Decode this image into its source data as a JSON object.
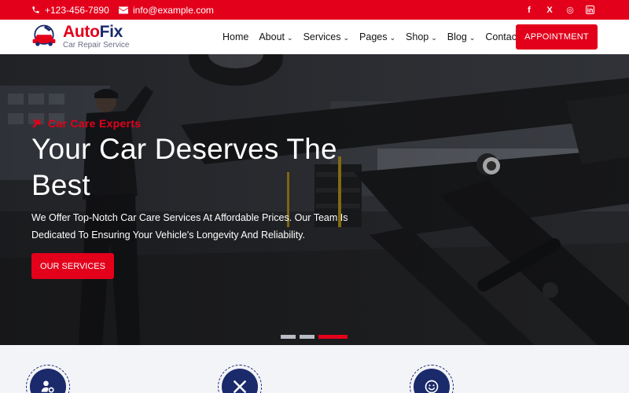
{
  "topbar": {
    "phone": "+123-456-7890",
    "email": "info@example.com",
    "social": [
      {
        "icon": "facebook-icon",
        "glyph": "f"
      },
      {
        "icon": "x-twitter-icon",
        "glyph": "X"
      },
      {
        "icon": "instagram-icon",
        "glyph": "◎"
      },
      {
        "icon": "linkedin-icon",
        "glyph": "in"
      }
    ]
  },
  "header": {
    "logo": {
      "brand_part1": "Auto",
      "brand_part2": "Fix",
      "tagline": "Car Repair Service"
    },
    "nav": [
      {
        "label": "Home",
        "dropdown": false
      },
      {
        "label": "About",
        "dropdown": true
      },
      {
        "label": "Services",
        "dropdown": true
      },
      {
        "label": "Pages",
        "dropdown": true
      },
      {
        "label": "Shop",
        "dropdown": true
      },
      {
        "label": "Blog",
        "dropdown": true
      },
      {
        "label": "Contact",
        "dropdown": false
      }
    ],
    "cta_label": "APPOINTMENT"
  },
  "hero": {
    "eyebrow": "Car Care Experts",
    "headline": "Your Car Deserves The Best",
    "subtext": "We Offer Top-Notch Car Care Services At Affordable Prices. Our Team Is Dedicated To Ensuring Your Vehicle's Longevity And Reliability.",
    "button_label": "OUR SERVICES",
    "slides": 3,
    "active_slide": 3
  },
  "features": [
    {
      "icon": "settings-user-icon"
    },
    {
      "icon": "tools-icon"
    },
    {
      "icon": "smile-icon"
    }
  ],
  "colors": {
    "accent": "#e3001b",
    "navy": "#1b2a6b"
  }
}
